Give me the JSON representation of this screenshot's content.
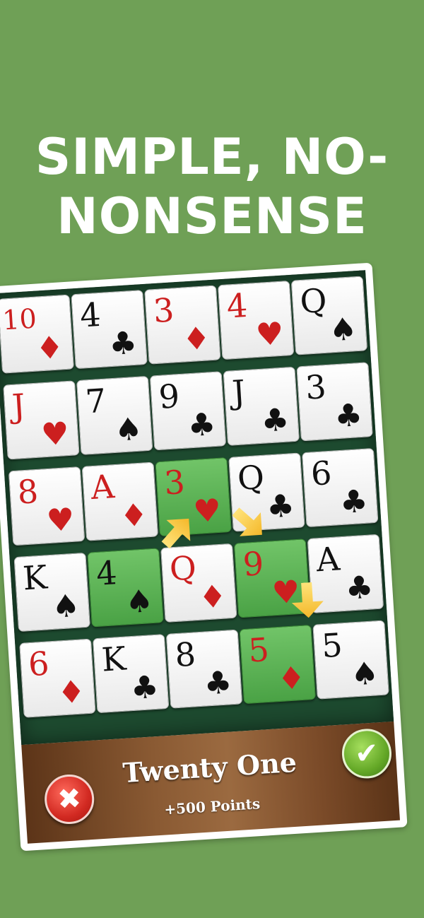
{
  "headline": {
    "line1": "SIMPLE, NO-",
    "line2": "NONSENSE"
  },
  "board": {
    "cards": [
      {
        "rank": "10",
        "suit": "♦",
        "color": "red",
        "selected": false
      },
      {
        "rank": "4",
        "suit": "♣",
        "color": "black",
        "selected": false
      },
      {
        "rank": "3",
        "suit": "♦",
        "color": "red",
        "selected": false
      },
      {
        "rank": "4",
        "suit": "♥",
        "color": "red",
        "selected": false
      },
      {
        "rank": "Q",
        "suit": "♠",
        "color": "black",
        "selected": false
      },
      {
        "rank": "J",
        "suit": "♥",
        "color": "red",
        "selected": false
      },
      {
        "rank": "7",
        "suit": "♠",
        "color": "black",
        "selected": false
      },
      {
        "rank": "9",
        "suit": "♣",
        "color": "black",
        "selected": false
      },
      {
        "rank": "J",
        "suit": "♣",
        "color": "black",
        "selected": false
      },
      {
        "rank": "3",
        "suit": "♣",
        "color": "black",
        "selected": false
      },
      {
        "rank": "8",
        "suit": "♥",
        "color": "red",
        "selected": false
      },
      {
        "rank": "A",
        "suit": "♦",
        "color": "red",
        "selected": false
      },
      {
        "rank": "3",
        "suit": "♥",
        "color": "red",
        "selected": true
      },
      {
        "rank": "Q",
        "suit": "♣",
        "color": "black",
        "selected": false
      },
      {
        "rank": "6",
        "suit": "♣",
        "color": "black",
        "selected": false
      },
      {
        "rank": "K",
        "suit": "♠",
        "color": "black",
        "selected": false
      },
      {
        "rank": "4",
        "suit": "♠",
        "color": "black",
        "selected": true
      },
      {
        "rank": "Q",
        "suit": "♦",
        "color": "red",
        "selected": false
      },
      {
        "rank": "9",
        "suit": "♥",
        "color": "red",
        "selected": true
      },
      {
        "rank": "A",
        "suit": "♣",
        "color": "black",
        "selected": false
      },
      {
        "rank": "6",
        "suit": "♦",
        "color": "red",
        "selected": false
      },
      {
        "rank": "K",
        "suit": "♣",
        "color": "black",
        "selected": false
      },
      {
        "rank": "8",
        "suit": "♣",
        "color": "black",
        "selected": false
      },
      {
        "rank": "5",
        "suit": "♦",
        "color": "red",
        "selected": true
      },
      {
        "rank": "5",
        "suit": "♠",
        "color": "black",
        "selected": false
      }
    ]
  },
  "result": {
    "title": "Twenty One",
    "points": "+500 Points",
    "cancel_icon": "✖",
    "confirm_icon": "✔"
  },
  "colors": {
    "background": "#6fa056",
    "felt": "#1d4a2f",
    "selected_card": "#5bb352",
    "red_suit": "#cc1f1f",
    "black_suit": "#111111",
    "arrow": "#f4b82a"
  }
}
